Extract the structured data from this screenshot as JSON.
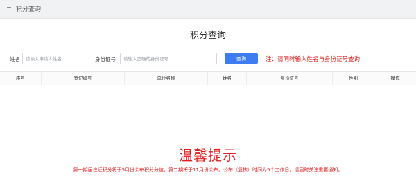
{
  "topbar": {
    "title": "积分查询"
  },
  "page": {
    "title": "积分查询"
  },
  "form": {
    "name_label": "姓名",
    "name_placeholder": "请输入申请人姓名",
    "id_label": "身份证号",
    "id_placeholder": "请输入正确的身份证号",
    "query_button": "查询",
    "note": "注：请同时输入姓名与身份证号查询"
  },
  "table": {
    "columns": [
      "序号",
      "登记编号",
      "单位名称",
      "姓名",
      "身份证号",
      "性别",
      "操作"
    ]
  },
  "notice": {
    "title": "温馨提示",
    "body": "第一期居住证积分将于5月份公布积分分值，第二期将于11月份公布。公布（复核）时间为5个工作日。请届时关注重要通知。"
  },
  "colors": {
    "accent": "#3d7df0",
    "warning": "#e02020"
  }
}
